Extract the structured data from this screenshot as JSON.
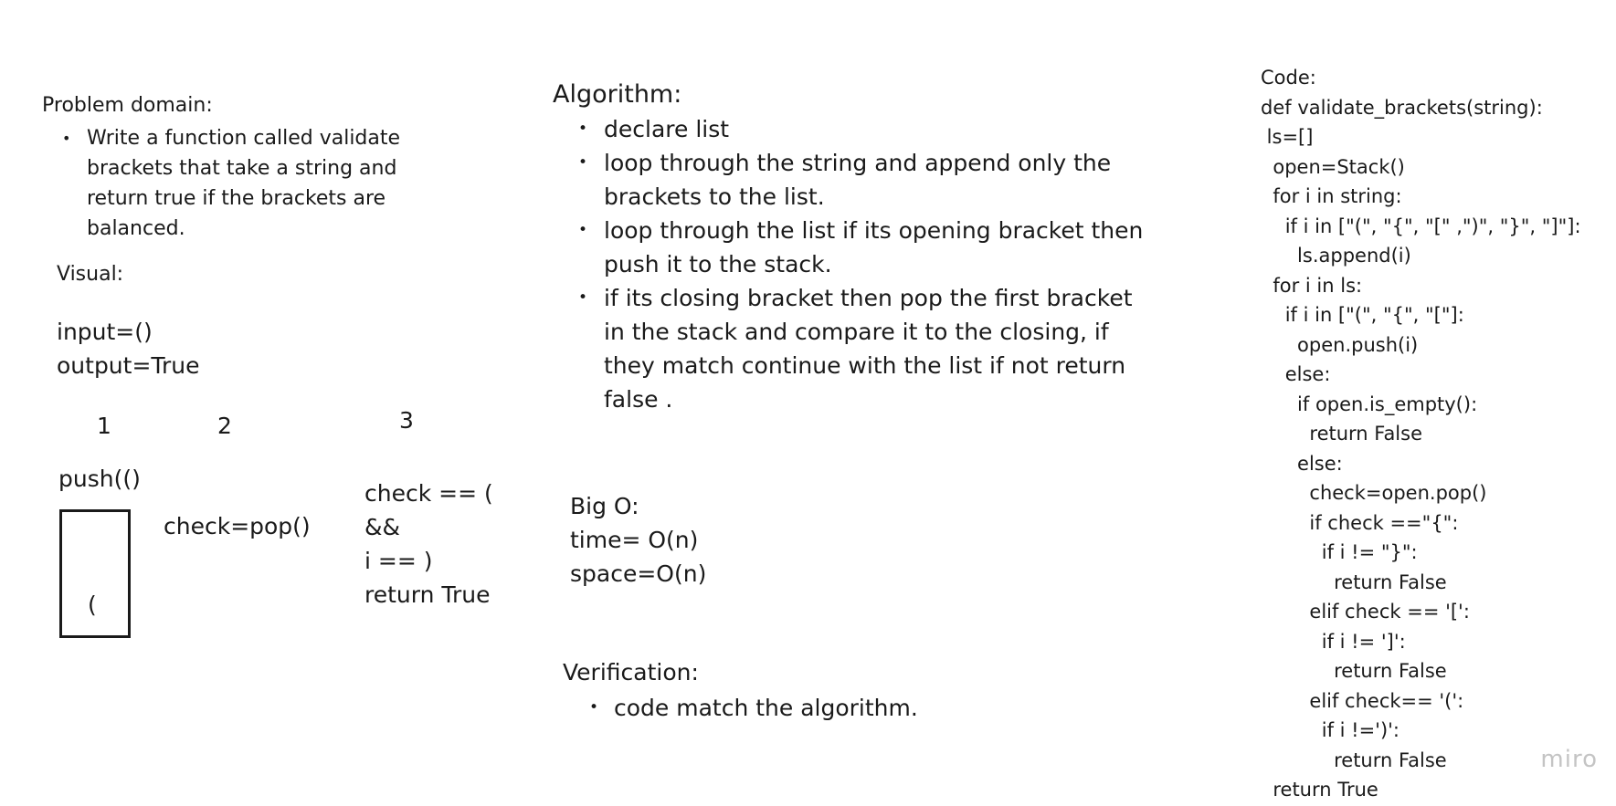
{
  "problem_domain": {
    "heading": "Problem domain:",
    "bullets": [
      "Write a function called validate brackets that take a string and return true if the brackets are balanced."
    ]
  },
  "visual": {
    "heading": "Visual:",
    "input": "input=()",
    "output": "output=True",
    "step_numbers": [
      "1",
      "2",
      "3"
    ],
    "step1_op": "push(()",
    "stack_item": "(",
    "step2_op": "check=pop()",
    "step3_lines": [
      "check == (",
      "&&",
      "i == )",
      "return True"
    ]
  },
  "algorithm": {
    "heading": "Algorithm:",
    "bullets": [
      "declare list",
      " loop through the string and append only the brackets to the list.",
      "loop through the list if its opening bracket then push it to the stack.",
      "if its closing bracket then pop the first bracket in the stack and compare it to the closing, if they match continue with the list if not  return false ."
    ]
  },
  "big_o": {
    "lines": [
      "Big O:",
      "time= O(n)",
      "space=O(n)"
    ]
  },
  "verification": {
    "heading": "Verification:",
    "bullets": [
      "code match the algorithm."
    ]
  },
  "code": {
    "lines": [
      "Code:",
      "def validate_brackets(string):",
      " ls=[]",
      "  open=Stack()",
      "  for i in string:",
      "    if i in [\"(\", \"{\", \"[\" ,\")\", \"}\", \"]\"]:",
      "      ls.append(i)",
      "  for i in ls:",
      "    if i in [\"(\", \"{\", \"[\"]:",
      "      open.push(i)",
      "    else:",
      "      if open.is_empty():",
      "        return False",
      "      else:",
      "        check=open.pop()",
      "        if check ==\"{\":",
      "          if i != \"}\":",
      "            return False",
      "        elif check == '[':",
      "          if i != ']':",
      "            return False",
      "        elif check== '(':",
      "          if i !=')':",
      "            return False",
      "  return True"
    ]
  },
  "watermark": "miro"
}
